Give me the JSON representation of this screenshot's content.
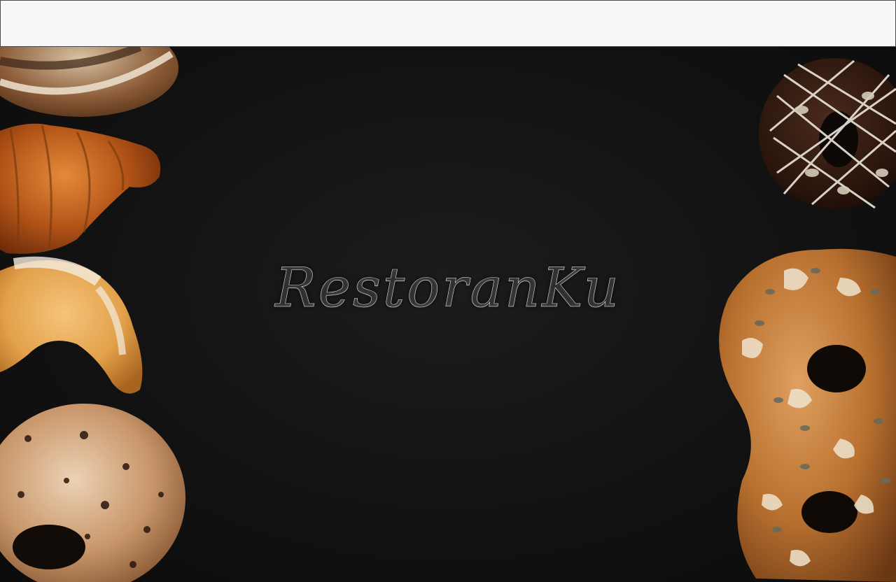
{
  "header": {},
  "hero": {
    "brand_text": "RestoranKu"
  },
  "colors": {
    "background": "#0f0f0f",
    "header_background": "#f7f7f7",
    "brand_text": "#e4e4e4"
  }
}
